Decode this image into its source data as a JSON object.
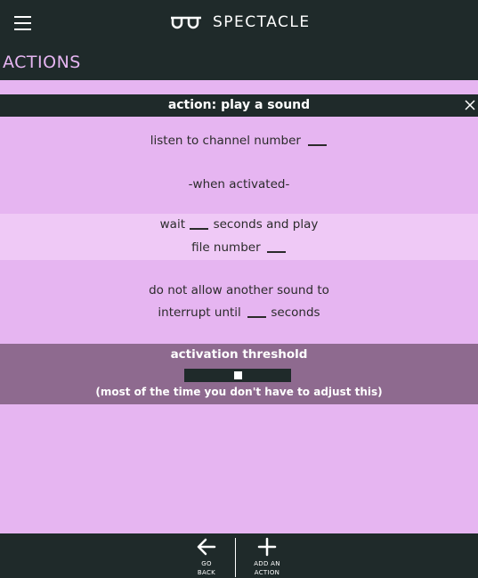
{
  "app": {
    "name": "SPECTACLE",
    "logo_icon": "spectacles-icon",
    "menu_icon": "hamburger-icon"
  },
  "page": {
    "title": "ACTIONS"
  },
  "action": {
    "header": "action: play a sound",
    "close_icon": "close-icon",
    "channel_label": "listen to channel number",
    "channel_value": "",
    "when_activated": "-when activated-",
    "wait_label": "wait",
    "wait_value": "",
    "seconds_and_play": "seconds and play",
    "file_number_label": "file number",
    "file_value": "",
    "no_interrupt_line1": "do not allow another sound to",
    "interrupt_until": "interrupt until",
    "interrupt_value": "",
    "seconds": "seconds"
  },
  "threshold": {
    "title": "activation threshold",
    "note": "(most of the time you don't have to adjust this)",
    "level": 0.5
  },
  "nav": {
    "back_label_1": "GO",
    "back_label_2": "BACK",
    "back_icon": "arrow-left-icon",
    "add_label_1": "ADD AN",
    "add_label_2": "ACTION",
    "add_icon": "plus-icon"
  },
  "colors": {
    "dark": "#1f2a2a",
    "background": "#e6b5f1",
    "band_light": "#efc9f6",
    "threshold_band": "#8e6a8f",
    "title_accent": "#e6b5f1"
  }
}
